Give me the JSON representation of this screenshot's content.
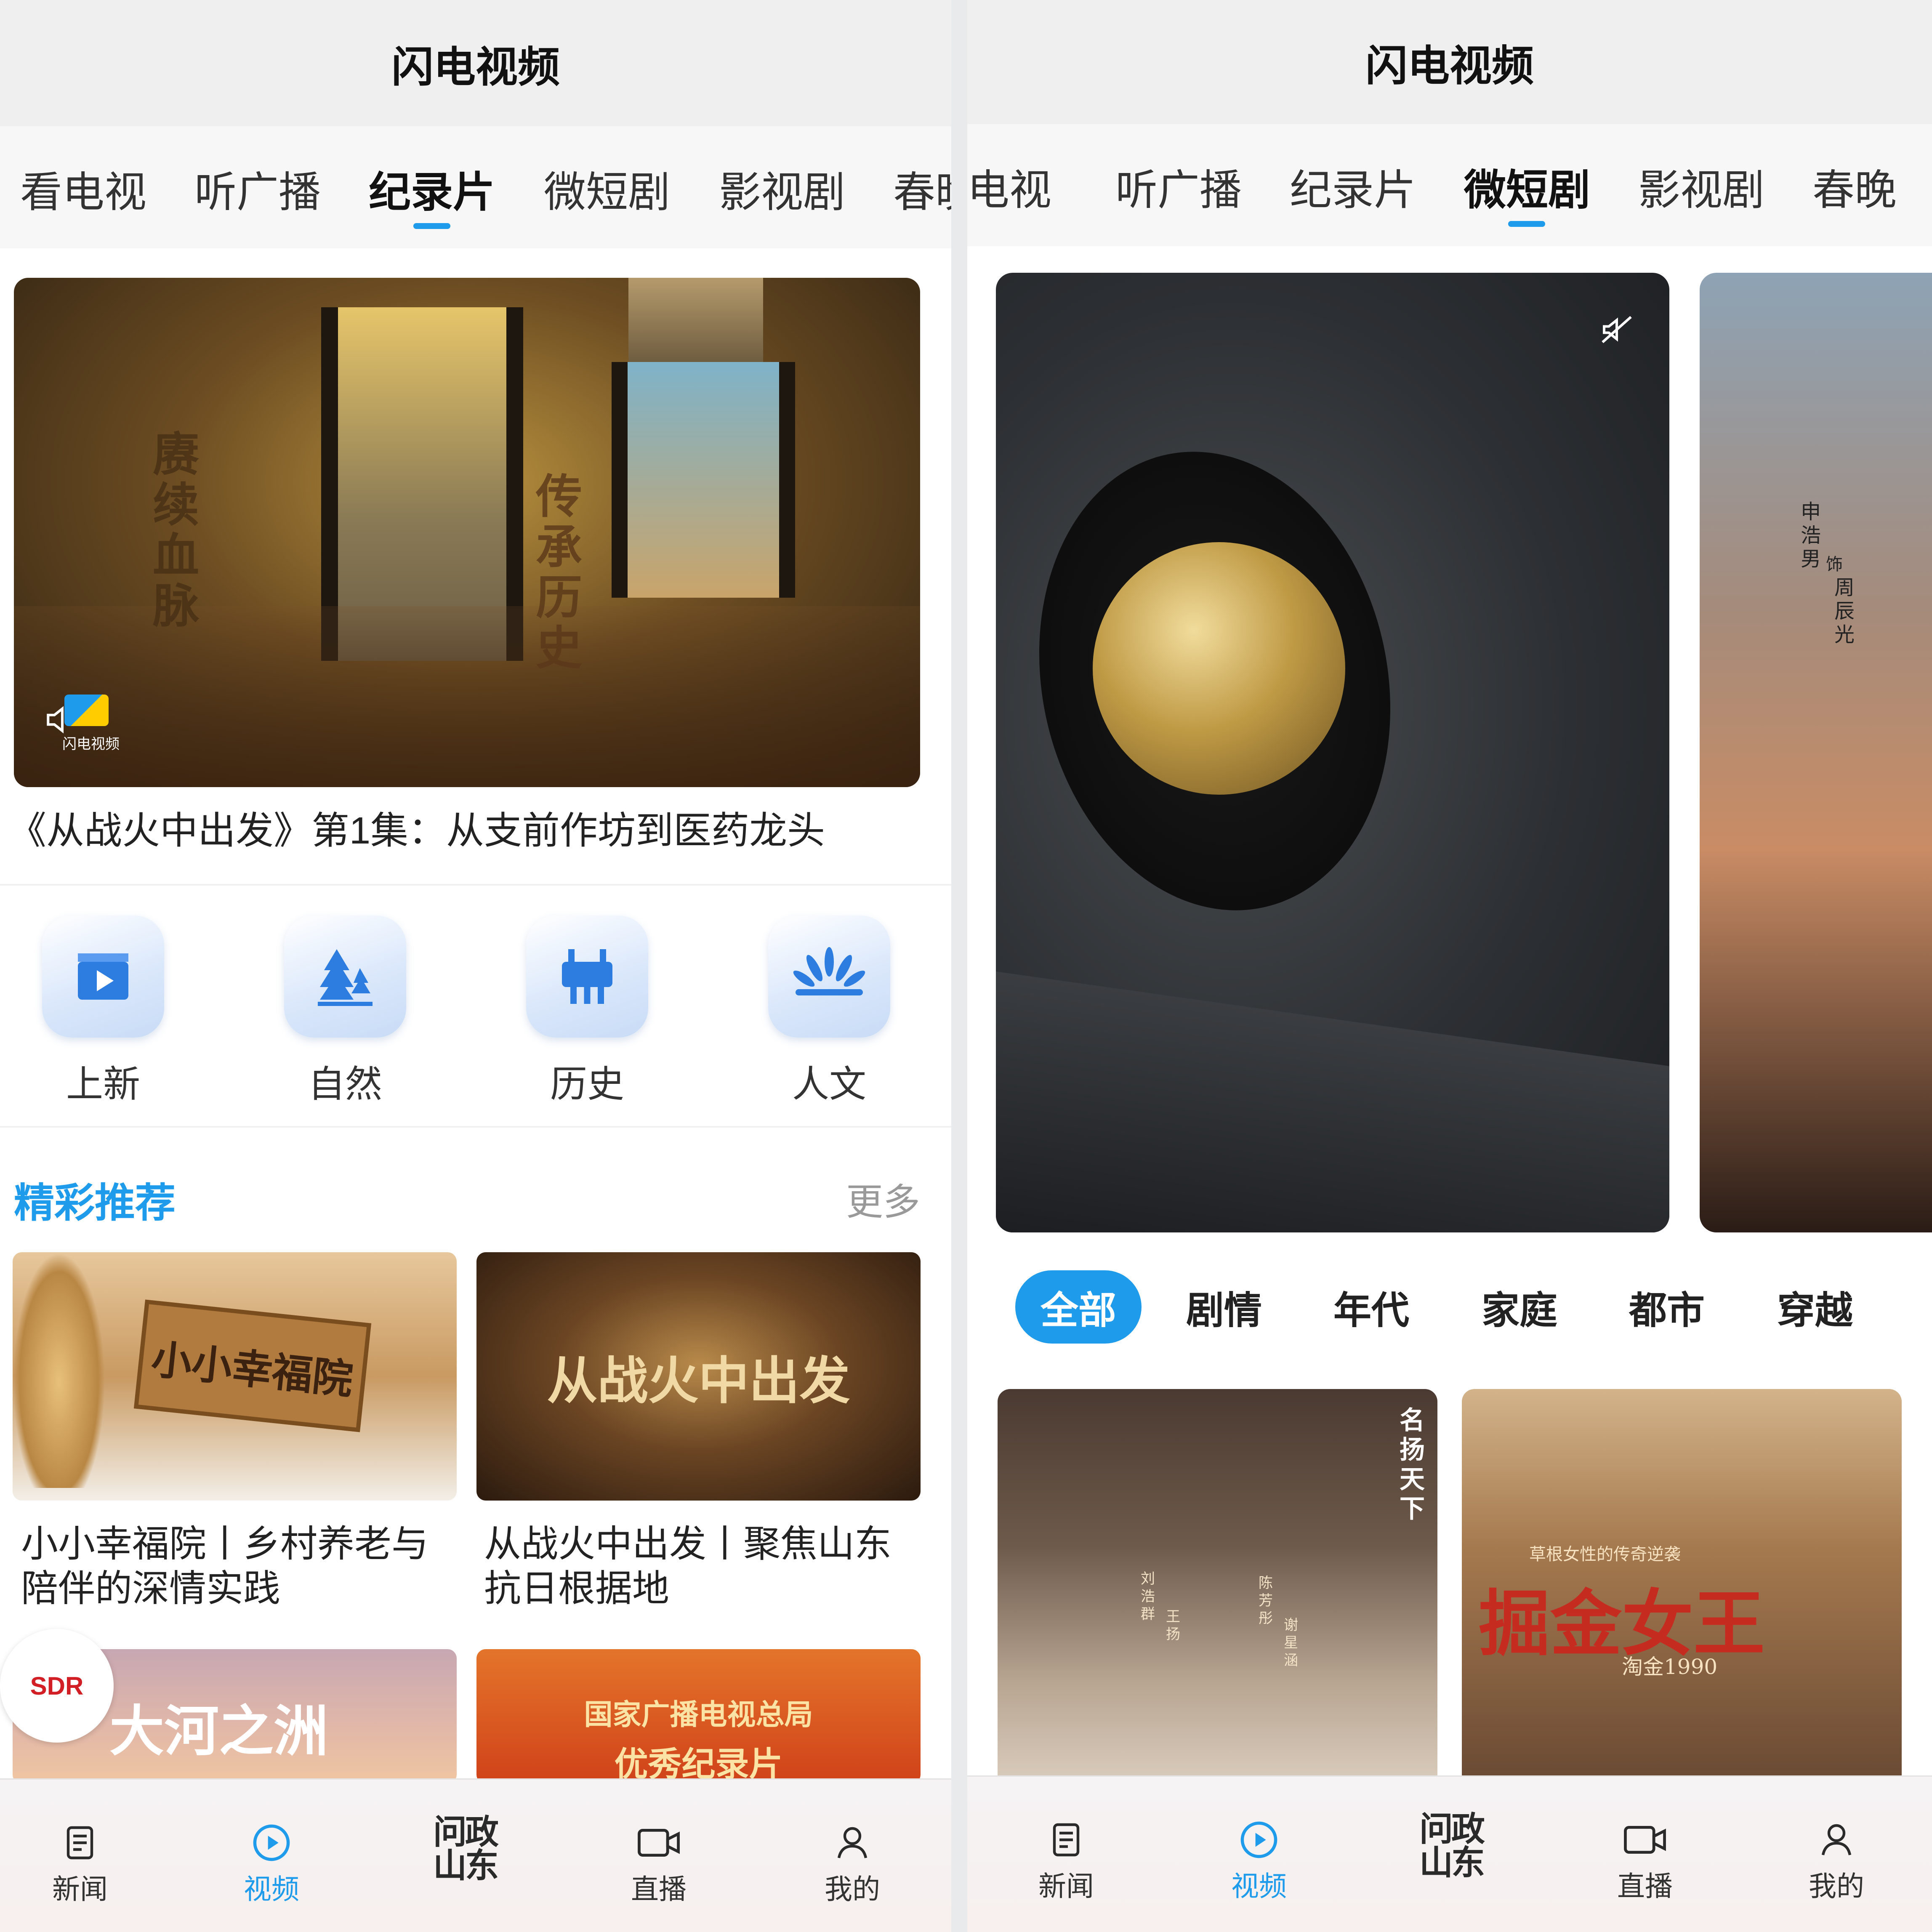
{
  "left": {
    "app_title": "闪电视频",
    "tabs": [
      "看电视",
      "听广播",
      "纪录片",
      "微短剧",
      "影视剧",
      "春晚"
    ],
    "active_tab": "纪录片",
    "banner": {
      "title": "《从战火中出发》第1集：从支前作坊到医药龙头",
      "overlay_left": "赓续血脉",
      "overlay_right": "传承历史",
      "watermark": "闪电视频"
    },
    "categories": [
      {
        "label": "上新",
        "icon": "clapperboard-play-icon"
      },
      {
        "label": "自然",
        "icon": "trees-icon"
      },
      {
        "label": "历史",
        "icon": "bronze-ding-icon"
      },
      {
        "label": "人文",
        "icon": "fan-shell-icon"
      }
    ],
    "section": {
      "title": "精彩推荐",
      "more": "更多"
    },
    "cards": [
      {
        "image_text": "小小幸福院",
        "title_line1": "小小幸福院丨乡村养老与",
        "title_line2": "陪伴的深情实践"
      },
      {
        "image_text": "从战火中出发",
        "title_line1": "从战火中出发丨聚焦山东",
        "title_line2": "抗日根据地"
      },
      {
        "image_text": "大河之洲",
        "badge": "SDR"
      },
      {
        "image_text_line1": "国家广播电视总局",
        "image_text_line2": "优秀纪录片"
      }
    ]
  },
  "right": {
    "app_title": "闪电视频",
    "tabs": [
      "看电视",
      "听广播",
      "纪录片",
      "微短剧",
      "影视剧",
      "春晚"
    ],
    "active_tab": "微短剧",
    "hero_side_text": [
      "申浩男",
      "饰",
      "周辰光"
    ],
    "filters": [
      "全部",
      "剧情",
      "年代",
      "家庭",
      "都市",
      "穿越"
    ],
    "active_filter": "全部",
    "posters": [
      {
        "names": [
          "刘浩群",
          "王扬",
          "陈芳彤",
          "谢星涵"
        ],
        "side_title": "名扬天下"
      },
      {
        "title": "掘金女王",
        "subtitle": "草根女性的传奇逆袭",
        "tag": "淘金1990"
      }
    ]
  },
  "bottom_nav": [
    {
      "label": "新闻",
      "icon": "newspaper-icon"
    },
    {
      "label": "视频",
      "icon": "play-circle-icon",
      "active": true
    },
    {
      "label": "问政山东",
      "icon": "wenzheng-logo-icon"
    },
    {
      "label": "直播",
      "icon": "camera-icon"
    },
    {
      "label": "我的",
      "icon": "person-icon"
    }
  ],
  "colors": {
    "accent": "#1e9bea",
    "text": "#222222",
    "muted": "#999999"
  }
}
